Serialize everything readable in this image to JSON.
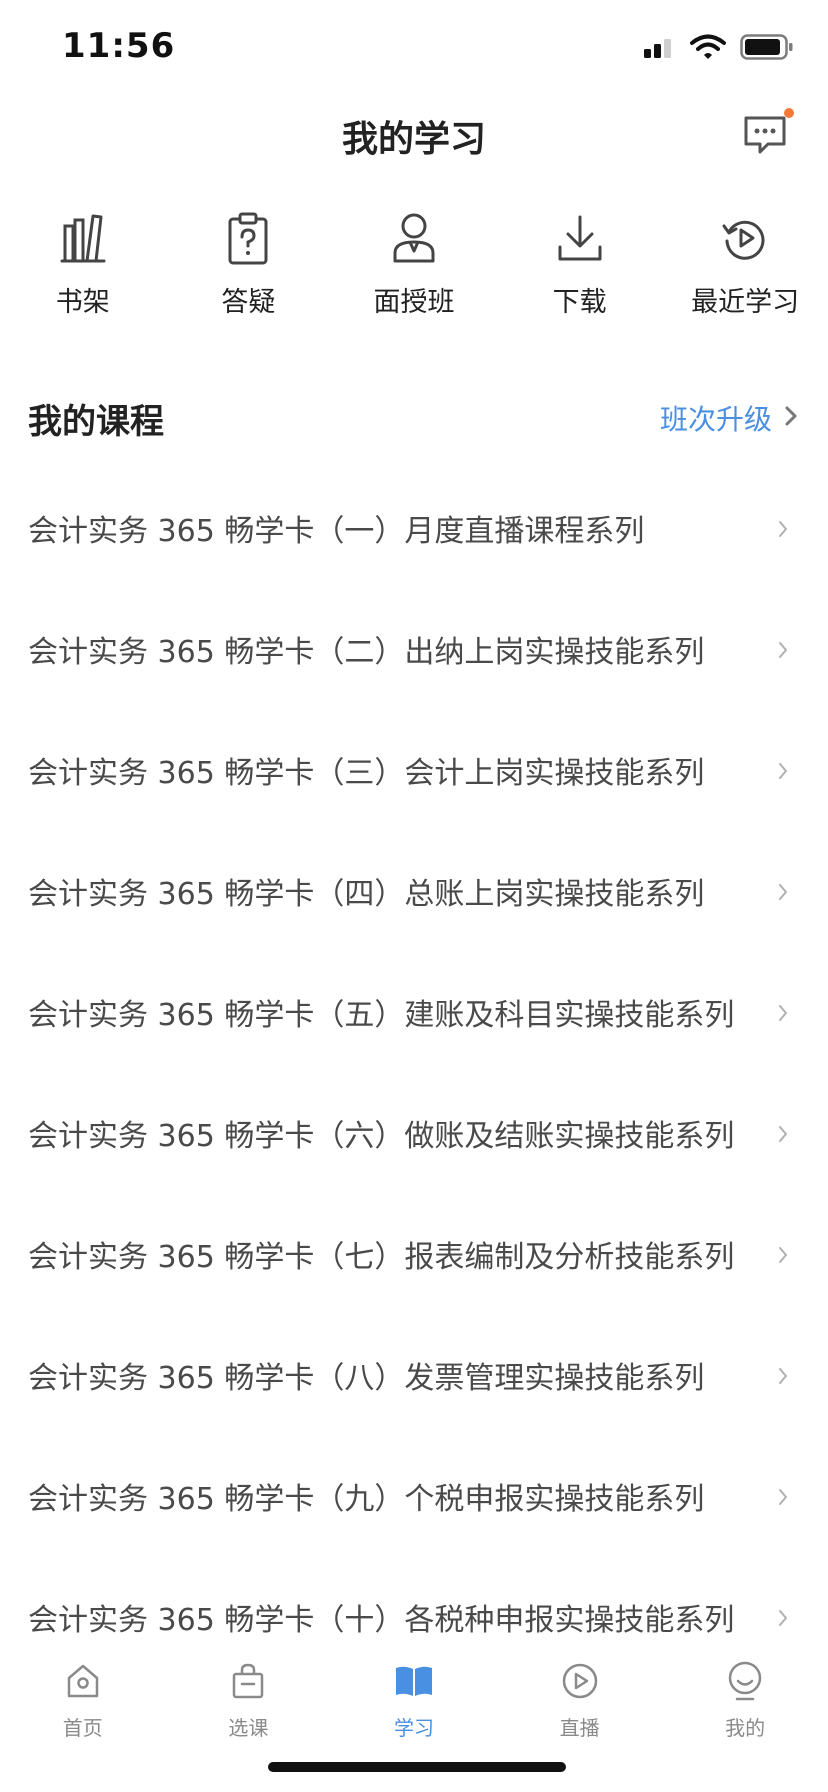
{
  "status_bar": {
    "time": "11:56"
  },
  "header": {
    "title": "我的学习"
  },
  "colors": {
    "accent": "#4a90e2",
    "badge": "#f47a3a"
  },
  "quick_entries": [
    {
      "label": "书架",
      "icon": "bookshelf-icon"
    },
    {
      "label": "答疑",
      "icon": "clipboard-question-icon"
    },
    {
      "label": "面授班",
      "icon": "teacher-icon"
    },
    {
      "label": "下载",
      "icon": "download-icon"
    },
    {
      "label": "最近学习",
      "icon": "recent-play-icon"
    }
  ],
  "section": {
    "title": "我的课程",
    "upgrade_label": "班次升级"
  },
  "courses": [
    {
      "title": "会计实务 365 畅学卡（一）月度直播课程系列"
    },
    {
      "title": "会计实务 365 畅学卡（二）出纳上岗实操技能系列"
    },
    {
      "title": "会计实务 365 畅学卡（三）会计上岗实操技能系列"
    },
    {
      "title": "会计实务 365 畅学卡（四）总账上岗实操技能系列"
    },
    {
      "title": "会计实务 365 畅学卡（五）建账及科目实操技能系列"
    },
    {
      "title": "会计实务 365 畅学卡（六）做账及结账实操技能系列"
    },
    {
      "title": "会计实务 365 畅学卡（七）报表编制及分析技能系列"
    },
    {
      "title": "会计实务 365 畅学卡（八）发票管理实操技能系列"
    },
    {
      "title": "会计实务 365 畅学卡（九）个税申报实操技能系列"
    },
    {
      "title": "会计实务 365 畅学卡（十）各税种申报实操技能系列"
    }
  ],
  "tabs": [
    {
      "label": "首页",
      "icon": "home-icon",
      "active": false
    },
    {
      "label": "选课",
      "icon": "shopping-bag-icon",
      "active": false
    },
    {
      "label": "学习",
      "icon": "open-book-icon",
      "active": true
    },
    {
      "label": "直播",
      "icon": "play-circle-icon",
      "active": false
    },
    {
      "label": "我的",
      "icon": "smile-face-icon",
      "active": false
    }
  ]
}
